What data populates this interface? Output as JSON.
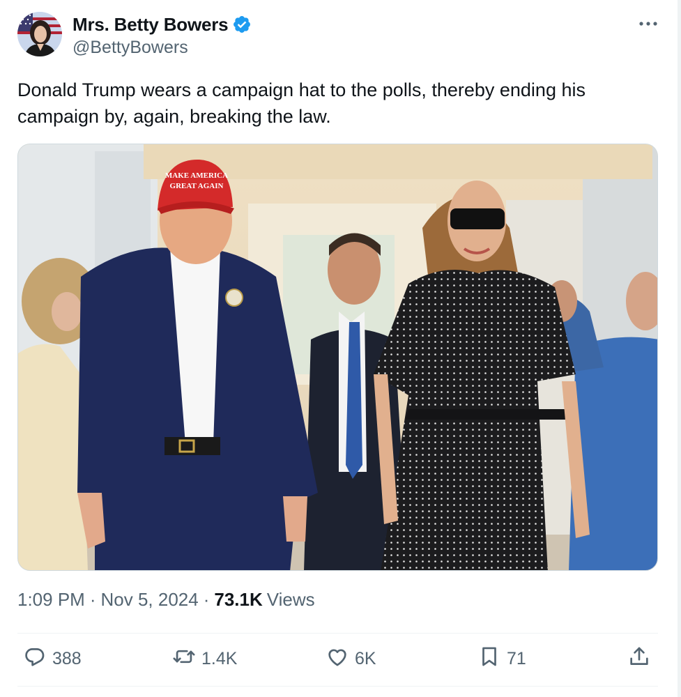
{
  "author": {
    "display_name": "Mrs. Betty Bowers",
    "handle": "@BettyBowers",
    "verified": true,
    "verified_color": "#1d9bf0"
  },
  "post": {
    "text": "Donald Trump wears a campaign hat to the polls, thereby ending his campaign by, again, breaking the law.",
    "media": {
      "hat_text_line1": "MAKE AMERICA",
      "hat_text_line2": "GREAT AGAIN"
    }
  },
  "meta": {
    "time": "1:09 PM",
    "separator": "·",
    "date": "Nov 5, 2024",
    "views_count": "73.1K",
    "views_label": "Views"
  },
  "actions": {
    "replies": "388",
    "reposts": "1.4K",
    "likes": "6K",
    "bookmarks": "71"
  },
  "icons": [
    "more-icon",
    "verified-icon",
    "reply-icon",
    "repost-icon",
    "like-icon",
    "bookmark-icon",
    "share-icon"
  ],
  "colors": {
    "text_primary": "#0f1419",
    "text_secondary": "#536471",
    "border": "#cfd9de"
  }
}
